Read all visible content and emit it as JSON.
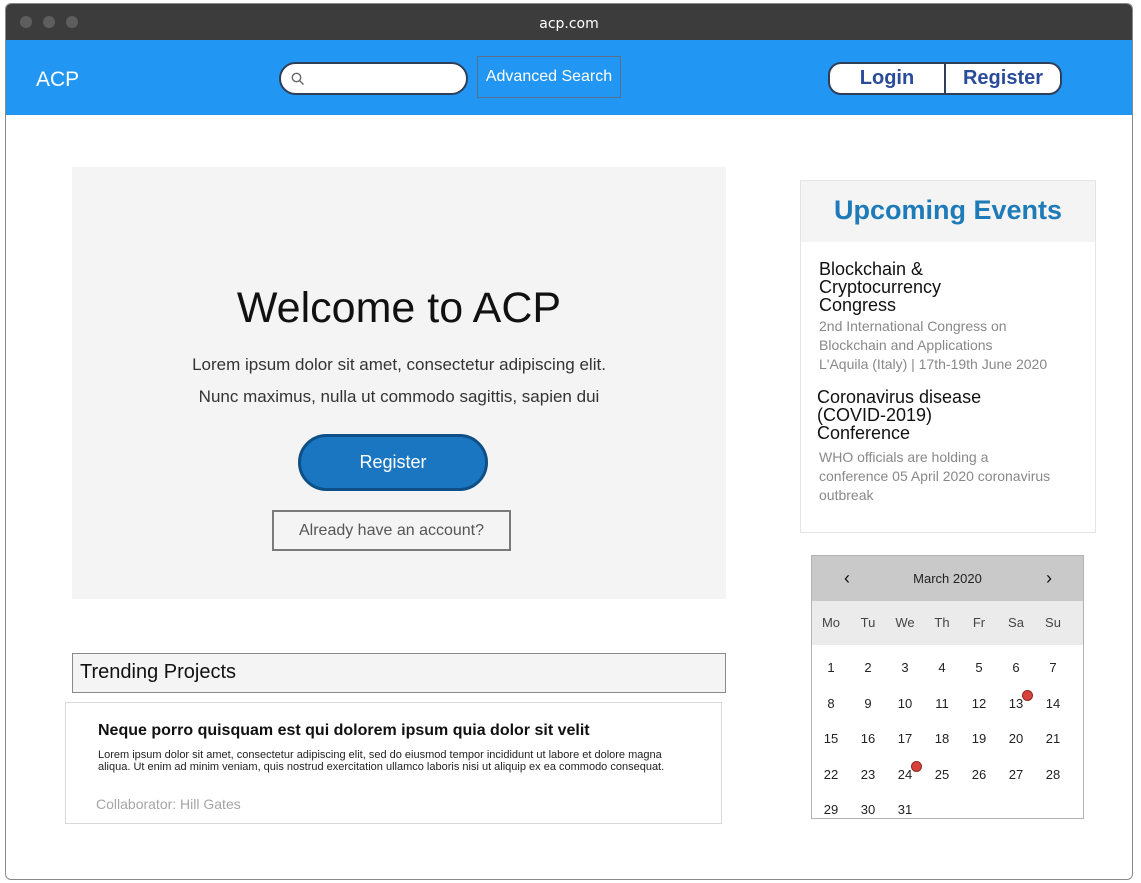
{
  "window": {
    "title": "acp.com"
  },
  "navbar": {
    "brand": "ACP",
    "search": {
      "value": "",
      "placeholder": ""
    },
    "advanced_search_label": "Advanced Search",
    "login_label": "Login",
    "register_label": "Register",
    "accent_color": "#2196f3"
  },
  "hero": {
    "title": "Welcome to ACP",
    "line1": "Lorem ipsum dolor sit amet, consectetur adipiscing elit.",
    "line2": "Nunc maximus, nulla ut commodo sagittis, sapien dui",
    "register_label": "Register",
    "already_label": "Already have an account?"
  },
  "trending": {
    "heading": "Trending Projects",
    "item": {
      "title": "Neque porro quisquam est qui dolorem ipsum quia dolor sit velit",
      "body": "Lorem ipsum dolor sit amet, consectetur adipiscing elit, sed do eiusmod tempor incididunt ut labore et dolore magna aliqua. Ut enim ad minim veniam, quis nostrud exercitation ullamco laboris nisi ut aliquip ex ea commodo consequat.",
      "collaborator": "Collaborator: Hill Gates"
    }
  },
  "events": {
    "heading": "Upcoming Events",
    "items": [
      {
        "title_lines": [
          "Blockchain &",
          "Cryptocurrency",
          "Congress"
        ],
        "desc_lines": [
          "2nd International Congress on",
          "Blockchain and Applications",
          "L'Aquila (Italy) | 17th-19th June 2020"
        ]
      },
      {
        "title_lines": [
          "Coronavirus disease",
          "(COVID-2019)",
          "Conference"
        ],
        "desc_lines": [
          "WHO officials are holding a",
          "conference 05 April 2020 coronavirus",
          "outbreak"
        ]
      }
    ]
  },
  "calendar": {
    "month_label": "March 2020",
    "prev_icon": "‹",
    "next_icon": "›",
    "weekdays": [
      "Mo",
      "Tu",
      "We",
      "Th",
      "Fr",
      "Sa",
      "Su"
    ],
    "weeks": [
      [
        "1",
        "2",
        "3",
        "4",
        "5",
        "6",
        "7"
      ],
      [
        "8",
        "9",
        "10",
        "11",
        "12",
        "13",
        "14"
      ],
      [
        "15",
        "16",
        "17",
        "18",
        "19",
        "20",
        "21"
      ],
      [
        "22",
        "23",
        "24",
        "25",
        "26",
        "27",
        "28"
      ],
      [
        "29",
        "30",
        "31"
      ]
    ],
    "event_days": [
      "13",
      "24"
    ],
    "event_dot_color": "#d8423a"
  }
}
